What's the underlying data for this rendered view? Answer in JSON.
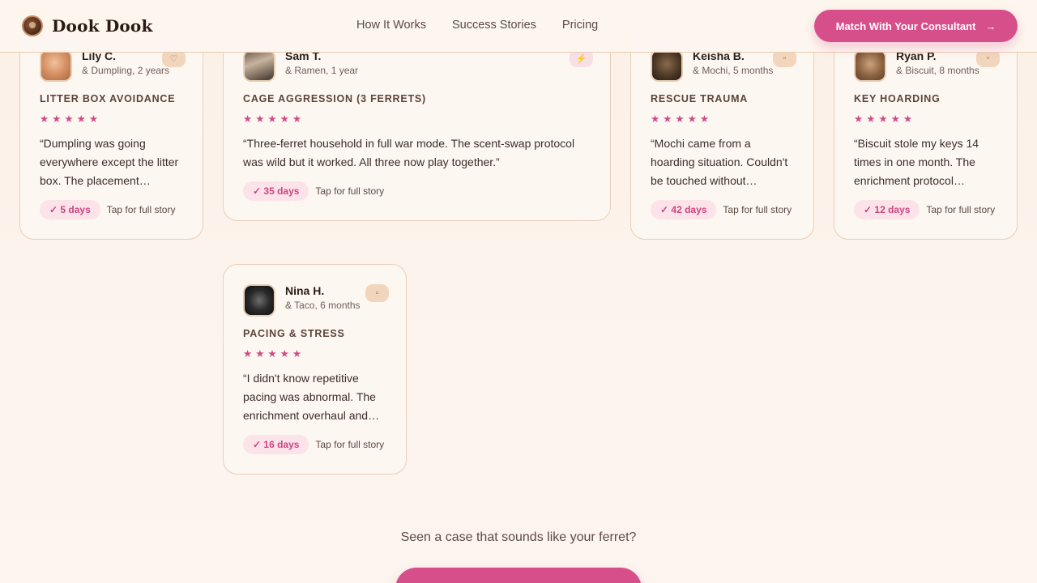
{
  "header": {
    "brand": "Dook Dook",
    "nav": [
      "How It Works",
      "Success Stories",
      "Pricing"
    ],
    "cta_label": "Match With Your Consultant",
    "cta_arrow": "→"
  },
  "cards": [
    {
      "name": "Lily C.",
      "pet": "& Dumpling, 2 years",
      "badge_icon": "heart-icon",
      "case": "LITTER BOX AVOIDANCE",
      "stars": "★★★★★",
      "quote": "“Dumpling was going everywhere except the litter box. The placement protocol…",
      "days": "✓ 5 days",
      "tap": "Tap for full story"
    },
    {
      "name": "Sam T.",
      "pet": "& Ramen, 1 year",
      "badge_icon": "lightning-icon",
      "badge_glyph": "⚡",
      "case": "CAGE AGGRESSION (3 FERRETS)",
      "stars": "★★★★★",
      "quote": "“Three-ferret household in full war mode. The scent-swap protocol was wild but it worked. All three now play together.”",
      "days": "✓ 35 days",
      "tap": "Tap for full story"
    },
    {
      "name": "Keisha B.",
      "pet": "& Mochi, 5 months",
      "badge_icon": "paw-icon",
      "case": "RESCUE TRAUMA",
      "stars": "★★★★★",
      "quote": "“Mochi came from a hoarding situation. Couldn't be touched without hissing…",
      "days": "✓ 42 days",
      "tap": "Tap for full story"
    },
    {
      "name": "Ryan P.",
      "pet": "& Biscuit, 8 months",
      "badge_icon": "key-icon",
      "case": "KEY HOARDING",
      "stars": "★★★★★",
      "quote": "“Biscuit stole my keys 14 times in one month. The enrichment protocol…",
      "days": "✓ 12 days",
      "tap": "Tap for full story"
    },
    {
      "name": "Nina H.",
      "pet": "& Taco, 6 months",
      "badge_icon": "paw-icon",
      "case": "PACING & STRESS",
      "stars": "★★★★★",
      "quote": "“I didn't know repetitive pacing was abnormal. The enrichment overhaul and…",
      "days": "✓ 16 days",
      "tap": "Tap for full story"
    }
  ],
  "bottom": {
    "question": "Seen a case that sounds like your ferret?"
  }
}
